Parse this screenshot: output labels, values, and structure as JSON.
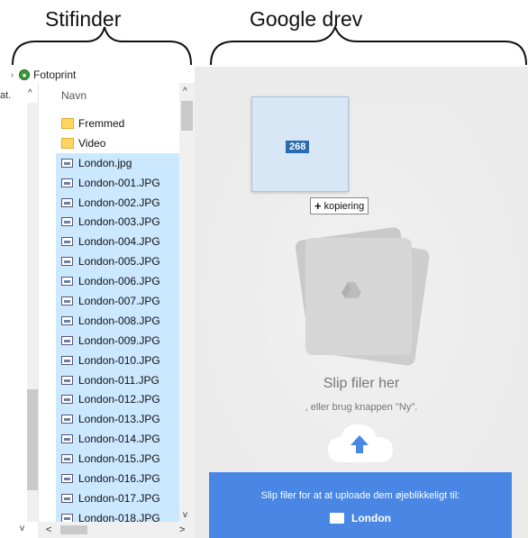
{
  "captions": {
    "left": "Stifinder",
    "right": "Google drev"
  },
  "explorer": {
    "breadcrumb": "Fotoprint",
    "nav_label": "at.",
    "column_header": "Navn",
    "files": [
      {
        "name": "Fremmed",
        "type": "folder",
        "selected": false
      },
      {
        "name": "Video",
        "type": "folder",
        "selected": false
      },
      {
        "name": "London.jpg",
        "type": "image",
        "selected": true
      },
      {
        "name": "London-001.JPG",
        "type": "image",
        "selected": true
      },
      {
        "name": "London-002.JPG",
        "type": "image",
        "selected": true
      },
      {
        "name": "London-003.JPG",
        "type": "image",
        "selected": true
      },
      {
        "name": "London-004.JPG",
        "type": "image",
        "selected": true
      },
      {
        "name": "London-005.JPG",
        "type": "image",
        "selected": true
      },
      {
        "name": "London-006.JPG",
        "type": "image",
        "selected": true
      },
      {
        "name": "London-007.JPG",
        "type": "image",
        "selected": true
      },
      {
        "name": "London-008.JPG",
        "type": "image",
        "selected": true
      },
      {
        "name": "London-009.JPG",
        "type": "image",
        "selected": true
      },
      {
        "name": "London-010.JPG",
        "type": "image",
        "selected": true
      },
      {
        "name": "London-011.JPG",
        "type": "image",
        "selected": true
      },
      {
        "name": "London-012.JPG",
        "type": "image",
        "selected": true
      },
      {
        "name": "London-013.JPG",
        "type": "image",
        "selected": true
      },
      {
        "name": "London-014.JPG",
        "type": "image",
        "selected": true
      },
      {
        "name": "London-015.JPG",
        "type": "image",
        "selected": true
      },
      {
        "name": "London-016.JPG",
        "type": "image",
        "selected": true
      },
      {
        "name": "London-017.JPG",
        "type": "image",
        "selected": true
      },
      {
        "name": "London-018.JPG",
        "type": "image",
        "selected": true
      }
    ]
  },
  "drive": {
    "drag_count": "268",
    "copy_tip": "kopiering",
    "drop_title": "Slip filer her",
    "drop_sub": ", eller brug knappen \"Ny\".",
    "banner_message": "Slip filer for at at uploade dem øjeblikkeligt til:",
    "banner_folder": "London"
  },
  "colors": {
    "selection": "#cce8ff",
    "banner": "#4a87e4",
    "drive_bg": "#ebebeb",
    "upload_arrow": "#4a87e4"
  }
}
